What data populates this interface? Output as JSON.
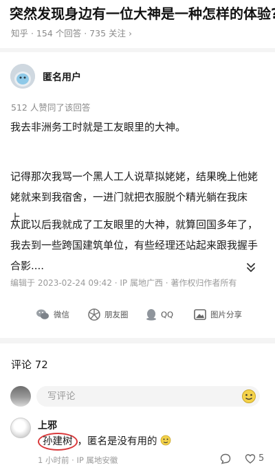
{
  "question": {
    "title": "突然发现身边有一位大神是一种怎样的体验?",
    "meta": "知乎 · 154 个回答 · 735 关注 ›"
  },
  "answer": {
    "author": "匿名用户",
    "votes": "512 人赞同了该回答",
    "paragraphs": [
      "我去非洲务工时就是工友眼里的大神。",
      "记得那次我骂一个黑人工人说草拟姥姥，结果晚上他姥姥就来到我宿舍，一进门就把衣服脱个精光躺在我床上.....",
      "从此以后我就成了工友眼里的大神，就算回国多年了，我去到一些跨国建筑单位，有些经理还站起来跟我握手合影...."
    ],
    "edit_info": "编辑于 2023-02-24 09:42 · IP 属地广西 · 著作权归作者所有"
  },
  "share": {
    "items": [
      {
        "label": "微信",
        "icon": "wechat-icon"
      },
      {
        "label": "朋友圈",
        "icon": "moments-icon"
      },
      {
        "label": "QQ",
        "icon": "qq-icon"
      },
      {
        "label": "图片分享",
        "icon": "image-share-icon"
      }
    ]
  },
  "comments": {
    "title": "评论 72",
    "input_placeholder": "写评论",
    "items": [
      {
        "author": "上邪",
        "name_part": "孙建树",
        "text_rest": "，匿名是没有用的",
        "meta": "1 小时前 · IP 属地安徽",
        "likes": "5"
      }
    ]
  },
  "colors": {
    "circle_annotation": "#d9383a",
    "muted_text": "#8a8a8a",
    "divider": "#f4f4f4"
  }
}
